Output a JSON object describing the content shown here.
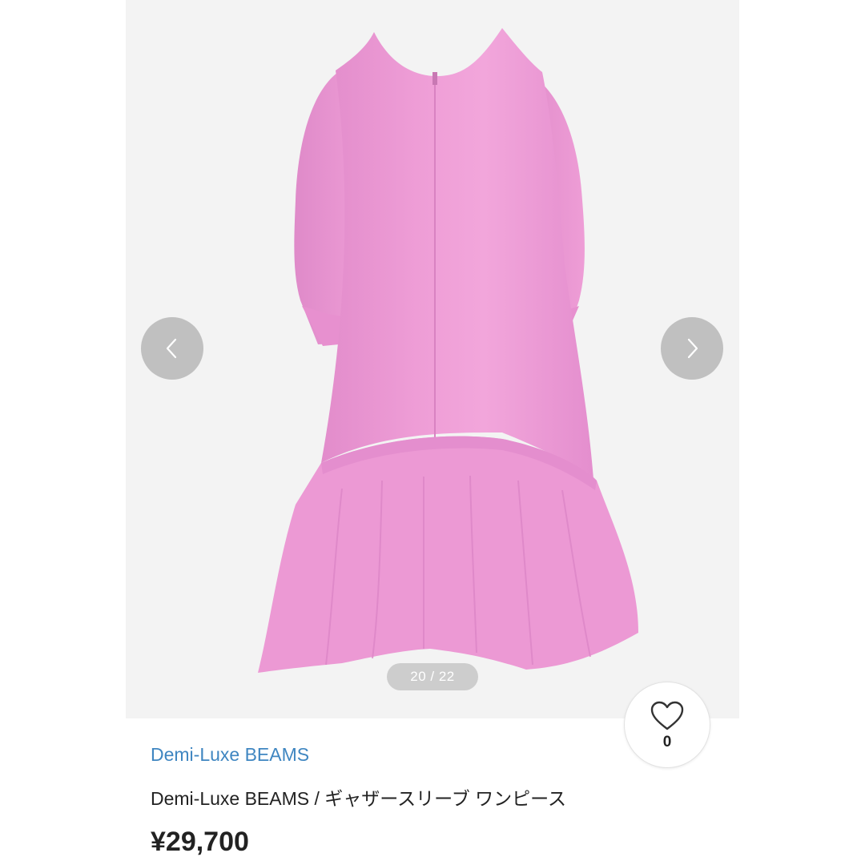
{
  "gallery": {
    "counter_text": "20 / 22",
    "image_subject": "pink-gathered-sleeve-dress-back-view",
    "prev_icon": "chevron-left-icon",
    "next_icon": "chevron-right-icon"
  },
  "favorite": {
    "icon": "heart-icon",
    "count": "0"
  },
  "product": {
    "brand": "Demi-Luxe BEAMS",
    "title": "Demi-Luxe BEAMS / ギャザースリーブ ワンピース",
    "price": "¥29,700"
  },
  "colors": {
    "gallery_bg": "#f3f3f3",
    "dress_pink": "#ee9cd5",
    "brand_link": "#3f86c1",
    "nav_button": "#969696"
  }
}
